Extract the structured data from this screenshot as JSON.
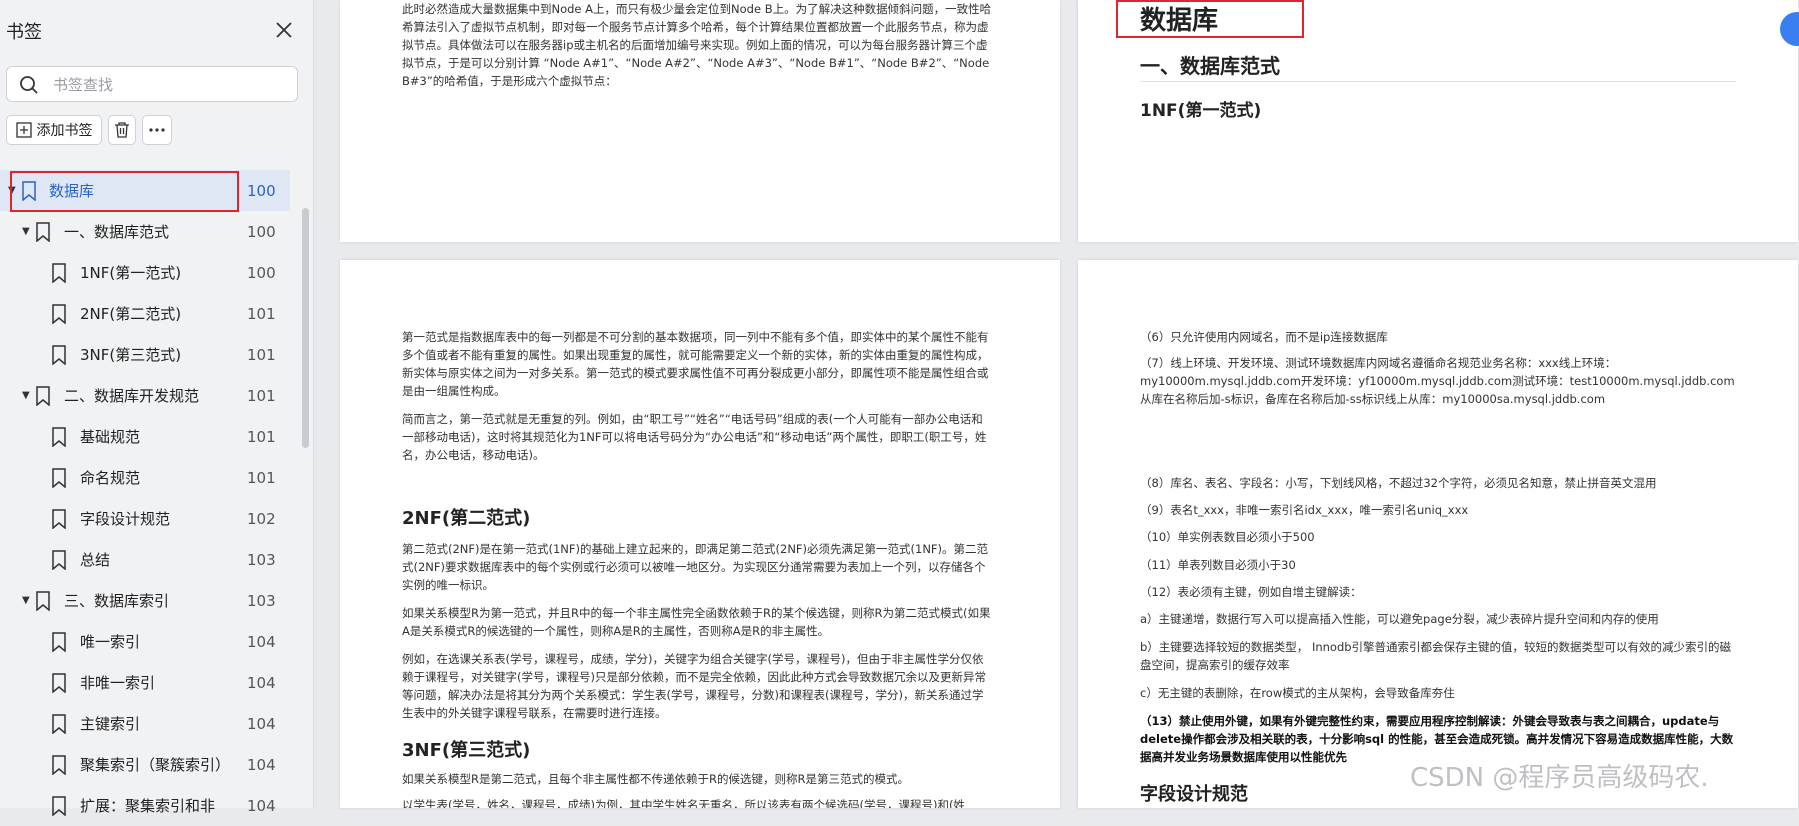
{
  "sidebar": {
    "title": "书签",
    "close_icon": "close-icon",
    "search_placeholder": "书签查找",
    "add_label": "添加书签",
    "items": [
      {
        "label": "数据库",
        "page": "100",
        "level": 0,
        "expanded": true
      },
      {
        "label": "一、数据库范式",
        "page": "100",
        "level": 1,
        "expanded": true
      },
      {
        "label": "1NF(第一范式)",
        "page": "100",
        "level": 2
      },
      {
        "label": "2NF(第二范式)",
        "page": "101",
        "level": 2
      },
      {
        "label": "3NF(第三范式)",
        "page": "101",
        "level": 2
      },
      {
        "label": "二、数据库开发规范",
        "page": "101",
        "level": 1,
        "expanded": true
      },
      {
        "label": "基础规范",
        "page": "101",
        "level": 2
      },
      {
        "label": "命名规范",
        "page": "101",
        "level": 2
      },
      {
        "label": "字段设计规范",
        "page": "102",
        "level": 2
      },
      {
        "label": "总结",
        "page": "103",
        "level": 2
      },
      {
        "label": "三、数据库索引",
        "page": "103",
        "level": 1,
        "expanded": true
      },
      {
        "label": "唯一索引",
        "page": "104",
        "level": 2
      },
      {
        "label": "非唯一索引",
        "page": "104",
        "level": 2
      },
      {
        "label": "主键索引",
        "page": "104",
        "level": 2
      },
      {
        "label": "聚集索引（聚簇索引）",
        "page": "104",
        "level": 2
      },
      {
        "label": "扩展：聚集索引和非",
        "page": "104",
        "level": 2
      }
    ],
    "accent": "#2a63c8",
    "highlight_color": "#e0252f"
  },
  "page_top_left": {
    "text": "此时必然造成大量数据集中到Node A上，而只有极少量会定位到Node B上。为了解决这种数据倾斜问题，一致性哈希算法引入了虚拟节点机制，即对每一个服务节点计算多个哈希，每个计算结果位置都放置一个此服务节点，称为虚拟节点。具体做法可以在服务器ip或主机名的后面增加编号来实现。例如上面的情况，可以为每台服务器计算三个虚拟节点，于是可以分别计算 “Node A#1”、“Node A#2”、“Node A#3”、“Node B#1”、“Node B#2”、“Node B#3”的哈希值，于是形成六个虚拟节点："
  },
  "page_top_right": {
    "h1": "数据库",
    "h2": "一、数据库范式",
    "h3": "1NF(第一范式)"
  },
  "page_bottom_left": {
    "p1": "第一范式是指数据库表中的每一列都是不可分割的基本数据项，同一列中不能有多个值，即实体中的某个属性不能有多个值或者不能有重复的属性。如果出现重复的属性，就可能需要定义一个新的实体，新的实体由重复的属性构成，新实体与原实体之间为一对多关系。第一范式的模式要求属性值不可再分裂成更小部分，即属性项不能是属性组合或是由一组属性构成。",
    "p2": "简而言之，第一范式就是无重复的列。例如，由“职工号”“姓名”“电话号码”组成的表(一个人可能有一部办公电话和一部移动电话)，这时将其规范化为1NF可以将电话号码分为“办公电话”和“移动电话”两个属性，即职工(职工号，姓名，办公电话，移动电话)。",
    "h_2nf": "2NF(第二范式)",
    "p3": "第二范式(2NF)是在第一范式(1NF)的基础上建立起来的，即满足第二范式(2NF)必须先满足第一范式(1NF)。第二范式(2NF)要求数据库表中的每个实例或行必须可以被唯一地区分。为实现区分通常需要为表加上一个列，以存储各个实例的唯一标识。",
    "p4": "如果关系模型R为第一范式，并且R中的每一个非主属性完全函数依赖于R的某个候选键，则称R为第二范式模式(如果A是关系模式R的候选键的一个属性，则称A是R的主属性，否则称A是R的非主属性。",
    "p5": "例如，在选课关系表(学号，课程号，成绩，学分)，关键字为组合关键字(学号，课程号)，但由于非主属性学分仅依赖于课程号，对关键字(学号，课程号)只是部分依赖，而不是完全依赖，因此此种方式会导致数据冗余以及更新异常等问题，解决办法是将其分为两个关系模式：学生表(学号，课程号，分数)和课程表(课程号，学分)，新关系通过学生表中的外关键字课程号联系，在需要时进行连接。",
    "h_3nf": "3NF(第三范式)",
    "p6": "如果关系模型R是第二范式，且每个非主属性都不传递依赖于R的候选键，则称R是第三范式的模式。",
    "p7": "以学生表(学号，姓名，课程号，成绩)为例，其中学生姓名无重名，所以该表有两个候选码(学号，课程号)和(姓"
  },
  "page_bottom_right": {
    "r6": "（6）只允许使用内网域名，而不是ip连接数据库",
    "r7": "（7）线上环境、开发环境、测试环境数据库内网域名遵循命名规范业务名称：xxx线上环境：my10000m.mysql.jddb.com开发环境：yf10000m.mysql.jddb.com测试环境：test10000m.mysql.jddb.com从库在名称后加-s标识，备库在名称后加-ss标识线上从库：my10000sa.mysql.jddb.com",
    "r8": "（8）库名、表名、字段名：小写，下划线风格，不超过32个字符，必须见名知意，禁止拼音英文混用",
    "r9": "（9）表名t_xxx，非唯一索引名idx_xxx，唯一索引名uniq_xxx",
    "r10": "（10）单实例表数目必须小于500",
    "r11": "（11）单表列数目必须小于30",
    "r12": "（12）表必须有主键，例如自增主键解读：",
    "ra": "a）主键递增，数据行写入可以提高插入性能，可以避免page分裂，减少表碎片提升空间和内存的使用",
    "rb": "b）主键要选择较短的数据类型， Innodb引擎普通索引都会保存主键的值，较短的数据类型可以有效的减少索引的磁盘空间，提高索引的缓存效率",
    "rc": "c）无主键的表删除，在row模式的主从架构，会导致备库夯住",
    "r13": "（13）禁止使用外键，如果有外键完整性约束，需要应用程序控制解读：外键会导致表与表之间耦合，update与delete操作都会涉及相关联的表，十分影响sql 的性能，甚至会造成死锁。高并发情况下容易造成数据库性能，大数据高并发业务场景数据库使用以性能优先",
    "h_field": "字段设计规范"
  },
  "watermark": "CSDN @程序员高级码农."
}
